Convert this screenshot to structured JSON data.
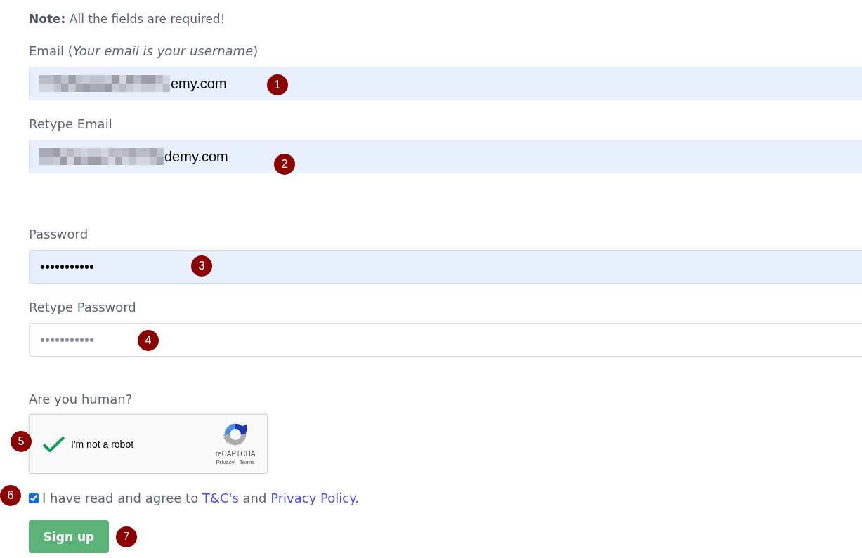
{
  "note": "**Note:** All the fields are required!",
  "fields": [
    {
      "label": "Email (*Your email is your username*)",
      "redacted": true,
      "value": "emy.com",
      "autofilled": true,
      "marker": "1"
    },
    {
      "label": "Retype Email",
      "redacted": true,
      "value": "demy.com",
      "autofilled": true,
      "marker": "2"
    },
    {
      "label": "Password",
      "redacted": false,
      "value": "•••••••••••",
      "autofilled": true,
      "marker": "3"
    },
    {
      "label": "Retype Password",
      "redacted": false,
      "placeholder": "•••••••••••",
      "autofilled": false,
      "marker": "4"
    }
  ],
  "captcha": {
    "question": "Are you human?",
    "verified": true,
    "label": "I'm not a robot",
    "brand": "reCAPTCHA",
    "links": "Privacy - Terms",
    "marker": "5"
  },
  "agreement": {
    "checked": true,
    "parts": [
      {
        "kind": "text",
        "text": "I have read and agree to "
      },
      {
        "kind": "link",
        "text": "T&C's"
      },
      {
        "kind": "text",
        "text": " and "
      },
      {
        "kind": "link",
        "text": "Privacy Policy"
      },
      {
        "kind": "text",
        "text": "."
      }
    ],
    "marker": "6"
  },
  "submit": {
    "label": "Sign up",
    "marker": "7"
  }
}
